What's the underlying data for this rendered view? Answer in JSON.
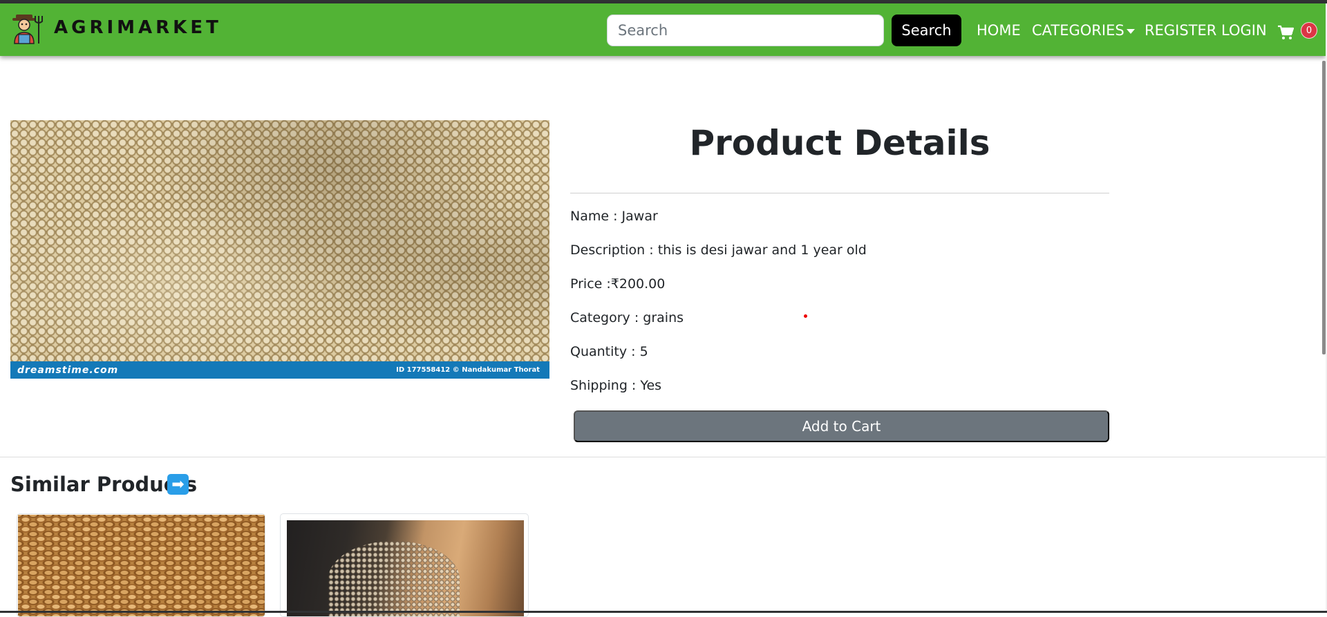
{
  "header": {
    "brand": "AGRIMARKET",
    "search_placeholder": "Search",
    "search_button": "Search",
    "nav": {
      "home": "HOME",
      "categories": "CATEGORIES",
      "register": "REGISTER",
      "login": "LOGIN"
    },
    "cart_count": "0"
  },
  "product": {
    "image_watermark_left": "dreamstime.com",
    "image_watermark_right": "ID 177558412 © Nandakumar Thorat",
    "title": "Product Details",
    "name": "Name : Jawar",
    "description": "Description : this is desi jawar and 1 year old",
    "price": "Price :₹200.00",
    "category": "Category : grains",
    "quantity": "Quantity : 5",
    "shipping": "Shipping : Yes",
    "add_to_cart": "Add to Cart"
  },
  "similar": {
    "title": "Similar Products",
    "arrow_glyph": "➡"
  },
  "colors": {
    "navbar": "#52b335",
    "add_to_cart_button": "#6c757d",
    "cart_badge": "#dc3545"
  }
}
